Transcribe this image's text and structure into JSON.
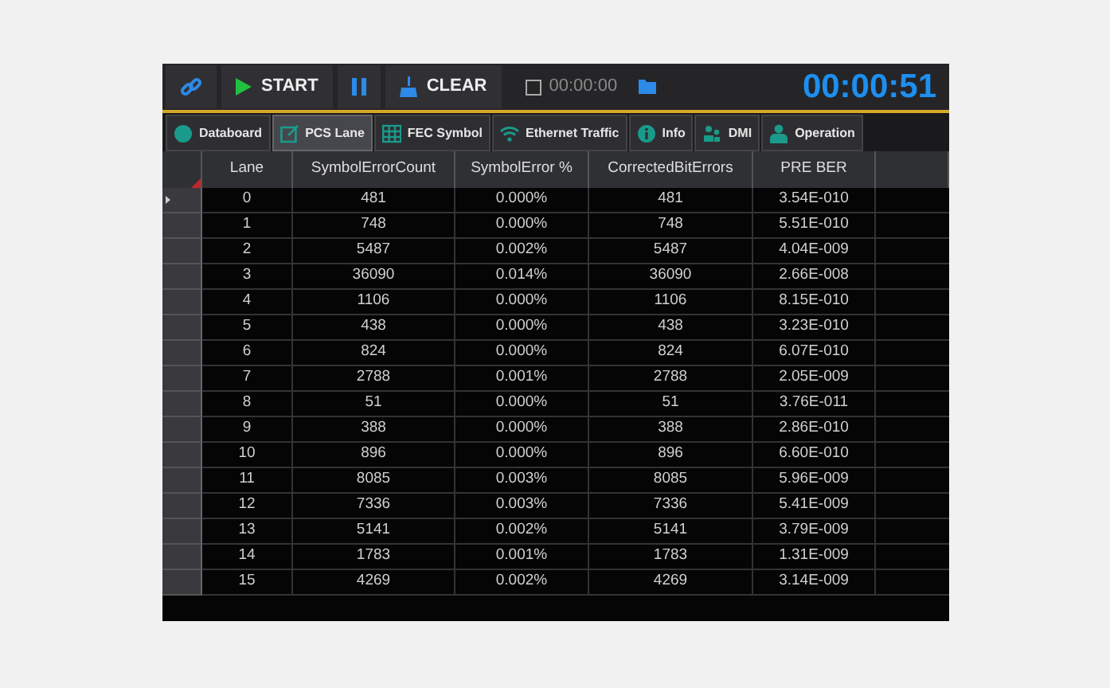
{
  "toolbar": {
    "buttons": [
      {
        "kind": "link"
      },
      {
        "kind": "start",
        "label": "START"
      },
      {
        "kind": "pause"
      },
      {
        "kind": "clear",
        "label": "CLEAR"
      }
    ],
    "record": {
      "checked": false,
      "time": "00:00:00"
    },
    "timer": "00:00:51"
  },
  "tabs": [
    {
      "label": "Databoard",
      "kind": "circle",
      "selected": false
    },
    {
      "label": "PCS  Lane",
      "kind": "edit",
      "selected": true
    },
    {
      "label": "FEC Symbol",
      "kind": "grid",
      "selected": false
    },
    {
      "label": "Ethernet Traffic",
      "kind": "wifi",
      "selected": false
    },
    {
      "label": "Info",
      "kind": "info",
      "selected": false
    },
    {
      "label": "DMI",
      "kind": "people",
      "selected": false
    },
    {
      "label": "Operation",
      "kind": "person",
      "selected": false
    }
  ],
  "table": {
    "columns": [
      "Lane",
      "SymbolErrorCount",
      "SymbolError %",
      "CorrectedBitErrors",
      "PRE BER"
    ],
    "rows": [
      {
        "selected": true,
        "cells": [
          "0",
          "481",
          "0.000%",
          "481",
          "3.54E-010"
        ]
      },
      {
        "selected": false,
        "cells": [
          "1",
          "748",
          "0.000%",
          "748",
          "5.51E-010"
        ]
      },
      {
        "selected": false,
        "cells": [
          "2",
          "5487",
          "0.002%",
          "5487",
          "4.04E-009"
        ]
      },
      {
        "selected": false,
        "cells": [
          "3",
          "36090",
          "0.014%",
          "36090",
          "2.66E-008"
        ]
      },
      {
        "selected": false,
        "cells": [
          "4",
          "1106",
          "0.000%",
          "1106",
          "8.15E-010"
        ]
      },
      {
        "selected": false,
        "cells": [
          "5",
          "438",
          "0.000%",
          "438",
          "3.23E-010"
        ]
      },
      {
        "selected": false,
        "cells": [
          "6",
          "824",
          "0.000%",
          "824",
          "6.07E-010"
        ]
      },
      {
        "selected": false,
        "cells": [
          "7",
          "2788",
          "0.001%",
          "2788",
          "2.05E-009"
        ]
      },
      {
        "selected": false,
        "cells": [
          "8",
          "51",
          "0.000%",
          "51",
          "3.76E-011"
        ]
      },
      {
        "selected": false,
        "cells": [
          "9",
          "388",
          "0.000%",
          "388",
          "2.86E-010"
        ]
      },
      {
        "selected": false,
        "cells": [
          "10",
          "896",
          "0.000%",
          "896",
          "6.60E-010"
        ]
      },
      {
        "selected": false,
        "cells": [
          "11",
          "8085",
          "0.003%",
          "8085",
          "5.96E-009"
        ]
      },
      {
        "selected": false,
        "cells": [
          "12",
          "7336",
          "0.003%",
          "7336",
          "5.41E-009"
        ]
      },
      {
        "selected": false,
        "cells": [
          "13",
          "5141",
          "0.002%",
          "5141",
          "3.79E-009"
        ]
      },
      {
        "selected": false,
        "cells": [
          "14",
          "1783",
          "0.001%",
          "1783",
          "1.31E-009"
        ]
      },
      {
        "selected": false,
        "cells": [
          "15",
          "4269",
          "0.002%",
          "4269",
          "3.14E-009"
        ]
      }
    ]
  }
}
